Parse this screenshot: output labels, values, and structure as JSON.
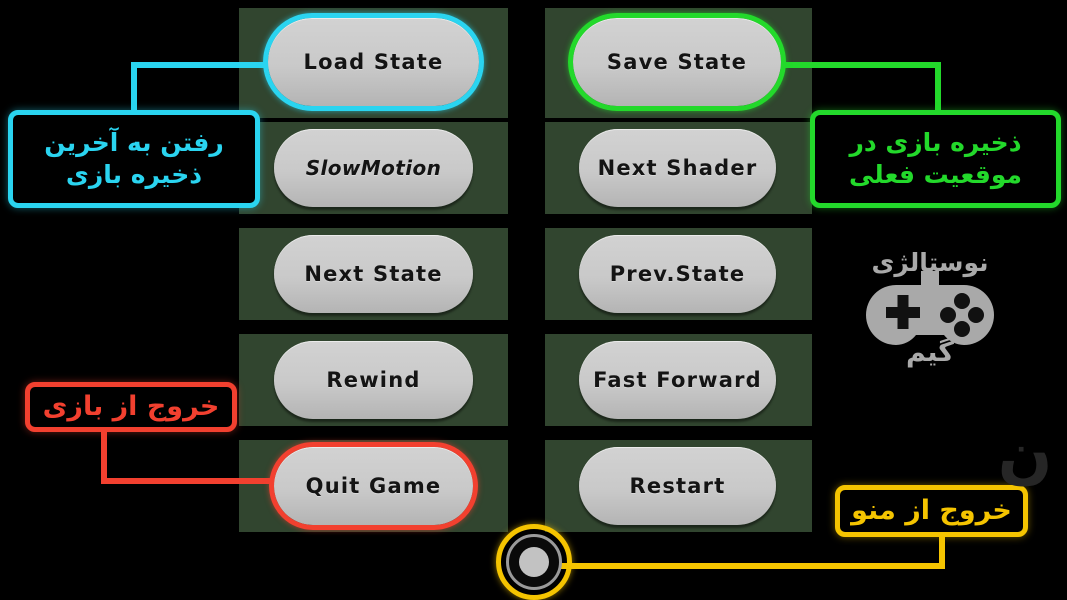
{
  "screen": {
    "background_color": "#000000",
    "panel_color": "#31452f"
  },
  "menu": {
    "buttons": [
      {
        "id": "load-state",
        "label": "Load State",
        "column": "left",
        "row": 1,
        "highlight": "cyan"
      },
      {
        "id": "save-state",
        "label": "Save State",
        "column": "right",
        "row": 1,
        "highlight": "green"
      },
      {
        "id": "slow-motion",
        "label": "SlowMotion",
        "column": "left",
        "row": 2,
        "highlight": "none"
      },
      {
        "id": "next-shader",
        "label": "Next Shader",
        "column": "right",
        "row": 2,
        "highlight": "none"
      },
      {
        "id": "next-state",
        "label": "Next State",
        "column": "left",
        "row": 3,
        "highlight": "none"
      },
      {
        "id": "prev-state",
        "label": "Prev.State",
        "column": "right",
        "row": 3,
        "highlight": "none"
      },
      {
        "id": "rewind",
        "label": "Rewind",
        "column": "left",
        "row": 4,
        "highlight": "none"
      },
      {
        "id": "fast-forward",
        "label": "Fast Forward",
        "column": "right",
        "row": 4,
        "highlight": "none"
      },
      {
        "id": "quit-game",
        "label": "Quit Game",
        "column": "left",
        "row": 5,
        "highlight": "red"
      },
      {
        "id": "restart",
        "label": "Restart",
        "column": "right",
        "row": 5,
        "highlight": "none"
      }
    ],
    "close_button": {
      "id": "close-menu",
      "label": "",
      "highlight": "yellow"
    }
  },
  "callouts": [
    {
      "id": "load-state-callout",
      "text": "رفتن به آخرین ذخیره بازی",
      "color": "#2ad4f0",
      "target": "load-state"
    },
    {
      "id": "save-state-callout",
      "text": "ذخیره بازی در موقعیت فعلی",
      "color": "#23d92b",
      "target": "save-state"
    },
    {
      "id": "quit-game-callout",
      "text": "خروج از بازی",
      "color": "#f2402f",
      "target": "quit-game"
    },
    {
      "id": "close-menu-callout",
      "text": "خروج از منو",
      "color": "#f5c400",
      "target": "close-menu"
    }
  ],
  "brand": {
    "top_text": "نوستالژی",
    "bottom_text": "گیم",
    "icon": "gamepad-icon",
    "color": "#a9a9a9"
  },
  "watermark": {
    "text": "ن",
    "color": "#262626"
  }
}
